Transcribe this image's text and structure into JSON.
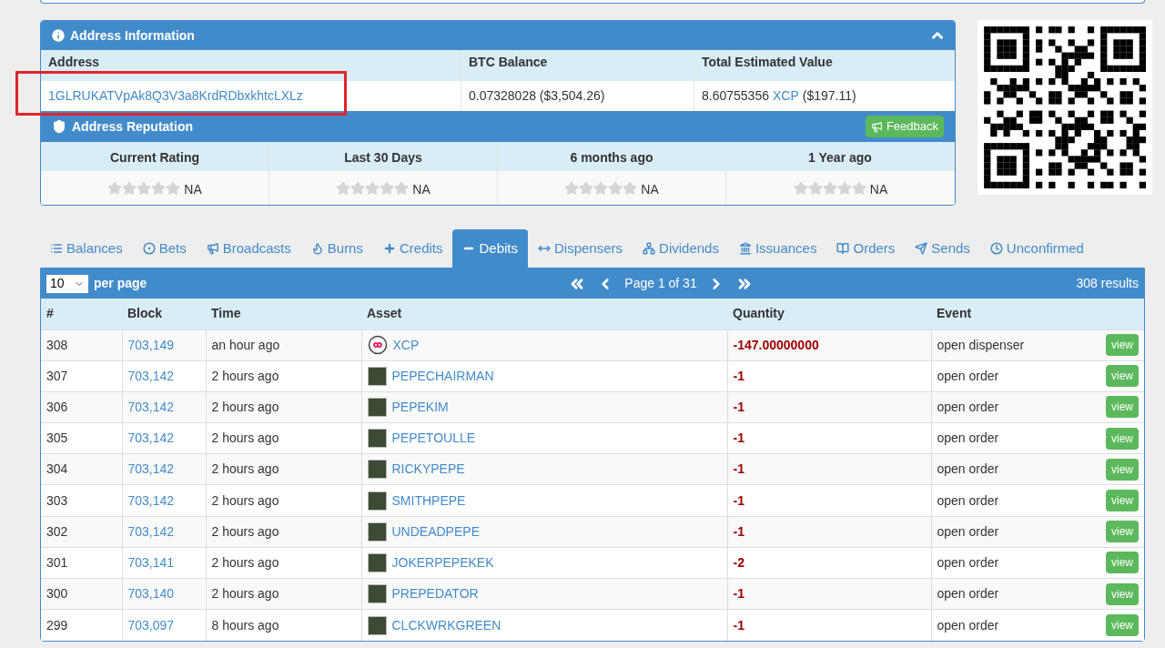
{
  "address_panel": {
    "title": "Address Information",
    "expanded": true,
    "columns": [
      "Address",
      "BTC Balance",
      "Total Estimated Value"
    ],
    "address": "1GLRUKATVpAk8Q3V3a8KrdRDbxkhtcLXLz",
    "btc_balance": "0.07328028 ($3,504.26)",
    "total_value": {
      "amount": "8.60755356",
      "asset": "XCP",
      "usd": "($197.11)"
    }
  },
  "reputation": {
    "title": "Address Reputation",
    "feedback_button": "Feedback",
    "ratings": [
      {
        "label": "Current Rating",
        "stars": 0,
        "value": "NA"
      },
      {
        "label": "Last 30 Days",
        "stars": 0,
        "value": "NA"
      },
      {
        "label": "6 months ago",
        "stars": 0,
        "value": "NA"
      },
      {
        "label": "1 Year ago",
        "stars": 0,
        "value": "NA"
      }
    ]
  },
  "tabs": [
    {
      "label": "Balances",
      "selected": false
    },
    {
      "label": "Bets",
      "selected": false
    },
    {
      "label": "Broadcasts",
      "selected": false
    },
    {
      "label": "Burns",
      "selected": false
    },
    {
      "label": "Credits",
      "selected": false
    },
    {
      "label": "Debits",
      "selected": true
    },
    {
      "label": "Dispensers",
      "selected": false
    },
    {
      "label": "Dividends",
      "selected": false
    },
    {
      "label": "Issuances",
      "selected": false
    },
    {
      "label": "Orders",
      "selected": false
    },
    {
      "label": "Sends",
      "selected": false
    },
    {
      "label": "Unconfirmed",
      "selected": false
    }
  ],
  "table": {
    "per_page": "10",
    "per_page_label": "per page",
    "page": "Page 1 of 31",
    "results": "308 results",
    "columns": [
      "#",
      "Block",
      "Time",
      "Asset",
      "Quantity",
      "Event"
    ],
    "rows": [
      {
        "num": "308",
        "block": "703,149",
        "time": "an hour ago",
        "asset": "XCP",
        "kind": "coin",
        "quantity": "-147.00000000",
        "event": "open dispenser",
        "view": "view"
      },
      {
        "num": "307",
        "block": "703,142",
        "time": "2 hours ago",
        "asset": "PEPECHAIRMAN",
        "kind": "image",
        "quantity": "-1",
        "event": "open order",
        "view": "view"
      },
      {
        "num": "306",
        "block": "703,142",
        "time": "2 hours ago",
        "asset": "PEPEKIM",
        "kind": "image",
        "quantity": "-1",
        "event": "open order",
        "view": "view"
      },
      {
        "num": "305",
        "block": "703,142",
        "time": "2 hours ago",
        "asset": "PEPETOULLE",
        "kind": "image",
        "quantity": "-1",
        "event": "open order",
        "view": "view"
      },
      {
        "num": "304",
        "block": "703,142",
        "time": "2 hours ago",
        "asset": "RICKYPEPE",
        "kind": "image",
        "quantity": "-1",
        "event": "open order",
        "view": "view"
      },
      {
        "num": "303",
        "block": "703,142",
        "time": "2 hours ago",
        "asset": "SMITHPEPE",
        "kind": "image",
        "quantity": "-1",
        "event": "open order",
        "view": "view"
      },
      {
        "num": "302",
        "block": "703,142",
        "time": "2 hours ago",
        "asset": "UNDEADPEPE",
        "kind": "image",
        "quantity": "-1",
        "event": "open order",
        "view": "view"
      },
      {
        "num": "301",
        "block": "703,141",
        "time": "2 hours ago",
        "asset": "JOKERPEPEKEK",
        "kind": "image",
        "quantity": "-2",
        "event": "open order",
        "view": "view"
      },
      {
        "num": "300",
        "block": "703,140",
        "time": "2 hours ago",
        "asset": "PREPEDATOR",
        "kind": "image",
        "quantity": "-1",
        "event": "open order",
        "view": "view"
      },
      {
        "num": "299",
        "block": "703,097",
        "time": "8 hours ago",
        "asset": "CLCKWRKGREEN",
        "kind": "image",
        "quantity": "-1",
        "event": "open order",
        "view": "view"
      }
    ]
  }
}
